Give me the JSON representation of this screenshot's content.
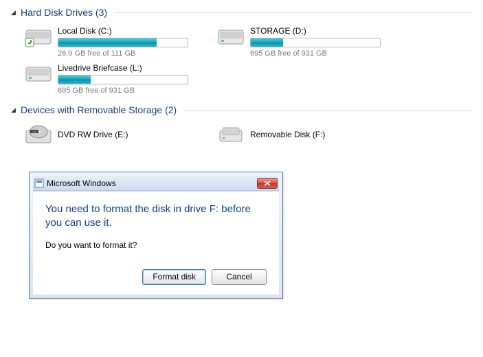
{
  "sections": {
    "hdd": {
      "title": "Hard Disk Drives (3)",
      "drives": [
        {
          "label": "Local Disk (C:)",
          "status": "26.9 GB free of 111 GB",
          "fillPercent": 76
        },
        {
          "label": "STORAGE (D:)",
          "status": "695 GB free of 931 GB",
          "fillPercent": 25
        },
        {
          "label": "Livedrive Briefcase (L:)",
          "status": "695 GB free of 931 GB",
          "fillPercent": 25
        }
      ]
    },
    "removable": {
      "title": "Devices with Removable Storage (2)",
      "drives": [
        {
          "label": "DVD RW Drive (E:)"
        },
        {
          "label": "Removable Disk (F:)"
        }
      ]
    }
  },
  "dialog": {
    "title": "Microsoft Windows",
    "heading": "You need to format the disk in drive F: before you can use it.",
    "question": "Do you want to format it?",
    "buttons": {
      "format": "Format disk",
      "cancel": "Cancel"
    }
  }
}
